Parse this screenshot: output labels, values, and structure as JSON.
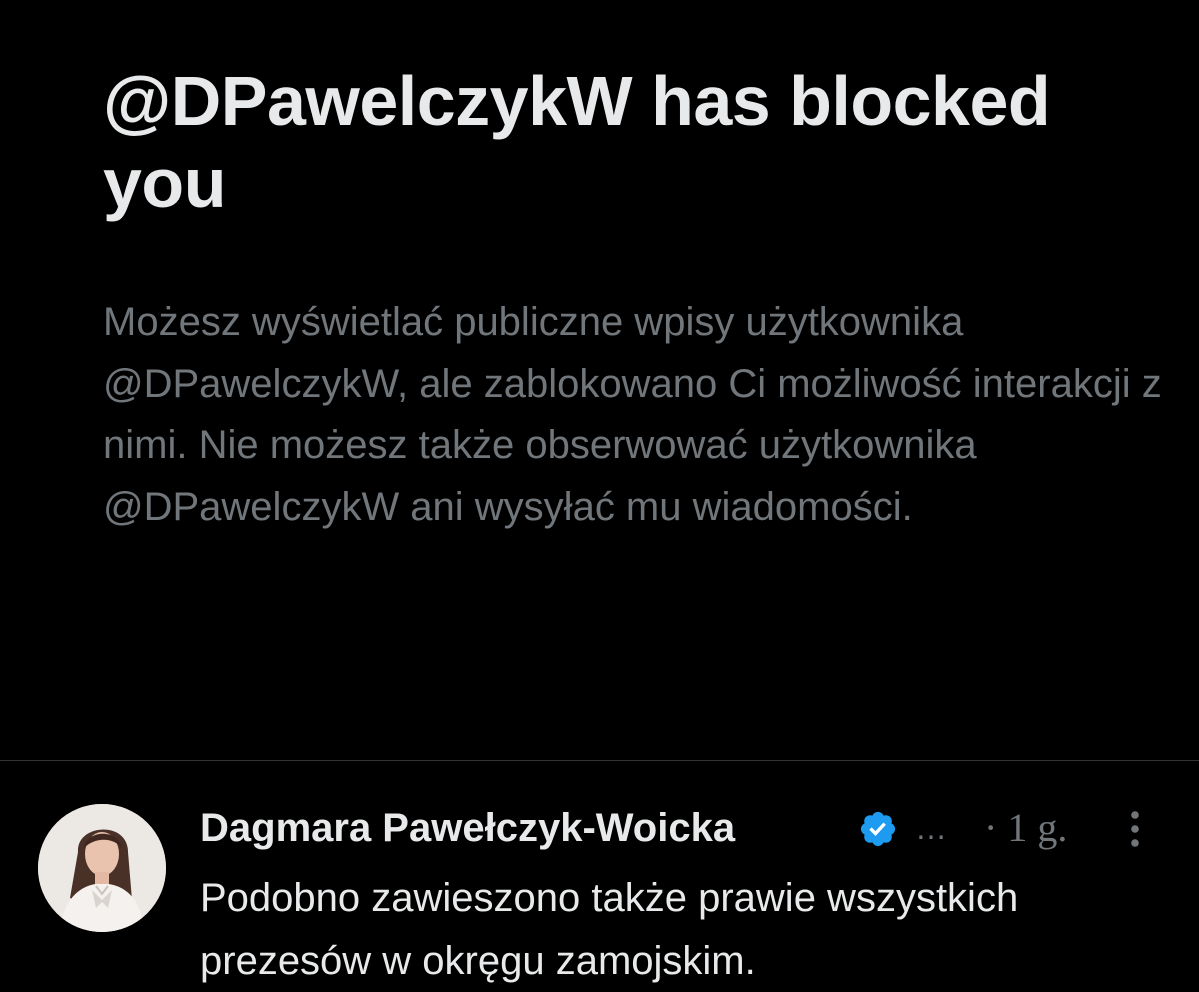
{
  "blocked": {
    "title": "@DPawelczykW has blocked you",
    "description": "Możesz wyświetlać publiczne wpisy użytkownika @DPawelczykW, ale zablokowano Ci możliwość interakcji z nimi. Nie możesz także obserwować użytkownika @DPawelczykW ani wysyłać mu wiadomości."
  },
  "tweet": {
    "author_name": "Dagmara Pawełczyk-Woicka",
    "verified_icon": "verified-badge-icon",
    "handle_truncated": "…",
    "time_ago": "· 1 g.",
    "more_icon": "more-vertical-icon",
    "text": "Podobno zawieszono także prawie wszystkich prezesów w okręgu zamojskim."
  },
  "colors": {
    "background": "#000000",
    "primary_text": "#e7e9ea",
    "secondary_text": "#71767b",
    "divider": "#2f3336",
    "verified_blue": "#1d9bf0"
  }
}
